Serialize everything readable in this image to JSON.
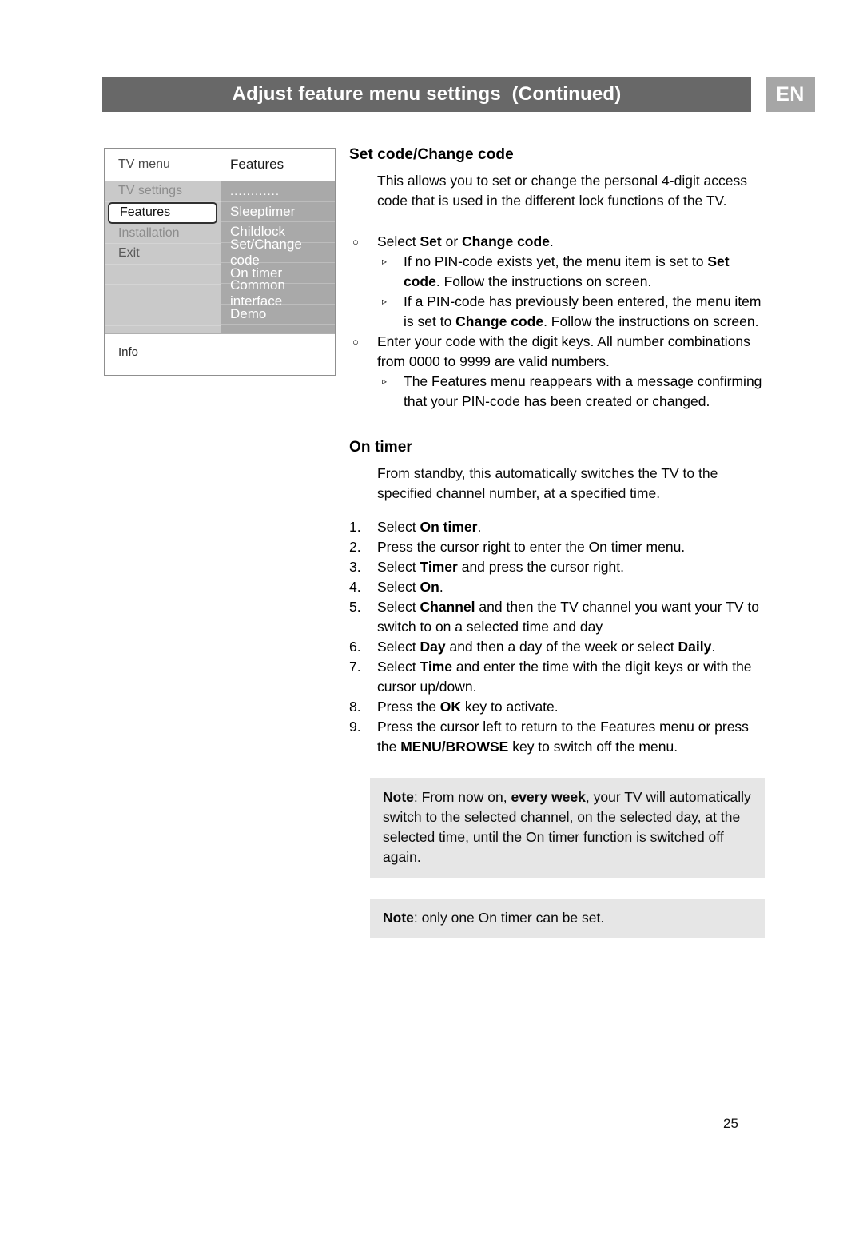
{
  "header": {
    "title": "Adjust feature menu settings  (Continued)",
    "language_badge": "EN",
    "bar_color": "#686868",
    "badge_color": "#a6a6a6"
  },
  "tv_menu": {
    "title_left": "TV menu",
    "title_right": "Features",
    "left_column": [
      {
        "label": "TV settings",
        "state": "dim"
      },
      {
        "label": "Features",
        "state": "selected"
      },
      {
        "label": "Installation",
        "state": "dim"
      },
      {
        "label": "Exit",
        "state": "normal"
      },
      {
        "label": "",
        "state": "blank"
      },
      {
        "label": "",
        "state": "blank"
      },
      {
        "label": "",
        "state": "blank"
      }
    ],
    "right_column": [
      {
        "label": "............",
        "state": "dots"
      },
      {
        "label": "Sleeptimer",
        "state": "normal"
      },
      {
        "label": "Childlock",
        "state": "normal"
      },
      {
        "label": "Set/Change code",
        "state": "normal"
      },
      {
        "label": "On timer",
        "state": "normal"
      },
      {
        "label": "Common interface",
        "state": "normal"
      },
      {
        "label": "Demo",
        "state": "normal"
      }
    ],
    "footer_label": "Info"
  },
  "section_setcode": {
    "heading": "Set code/Change code",
    "intro": "This allows you to set or change the personal 4-digit access code that is used in the different lock functions of the TV.",
    "bullets": [
      {
        "marker": "○",
        "text_html": "Select <b>Set</b> or <b>Change code</b>.",
        "sub": [
          {
            "marker": "▹",
            "text_html": "If no PIN-code exists yet, the menu item is set to <b>Set code</b>. Follow the instructions on screen."
          },
          {
            "marker": "▹",
            "text_html": "If a PIN-code has previously been entered, the menu item is set to <b>Change code</b>. Follow the instructions on screen."
          }
        ]
      },
      {
        "marker": "○",
        "text_html": "Enter your code with the digit keys. All number combinations from 0000 to 9999 are valid numbers.",
        "sub": [
          {
            "marker": "▹",
            "text_html": "The Features menu reappears with a message confirming that your PIN-code has been created or changed."
          }
        ]
      }
    ]
  },
  "section_ontimer": {
    "heading": "On timer",
    "intro": "From standby, this automatically switches the TV to the specified channel number, at a specified time.",
    "steps": [
      "Select <b>On timer</b>.",
      "Press the cursor right to enter the On timer menu.",
      "Select <b>Timer</b> and press the cursor right.",
      "Select <b>On</b>.",
      "Select <b>Channel</b> and then the TV channel you want your TV to switch to on a selected time and day",
      "Select <b>Day</b> and then a day of the week or select <b>Daily</b>.",
      "Select <b>Time</b> and enter the time with the digit keys or with the cursor up/down.",
      "Press the <b>OK</b> key to activate.",
      "Press the cursor left to return to the Features menu or press the <b>MENU/BROWSE</b> key to switch off the menu."
    ],
    "notes": [
      "<b>Note</b>: From now on, <b>every week</b>, your TV will automatically switch to the selected channel, on the selected day, at the selected time, until the On timer function is switched off again.",
      "<b>Note</b>: only one On timer can be set."
    ]
  },
  "page_number": "25"
}
